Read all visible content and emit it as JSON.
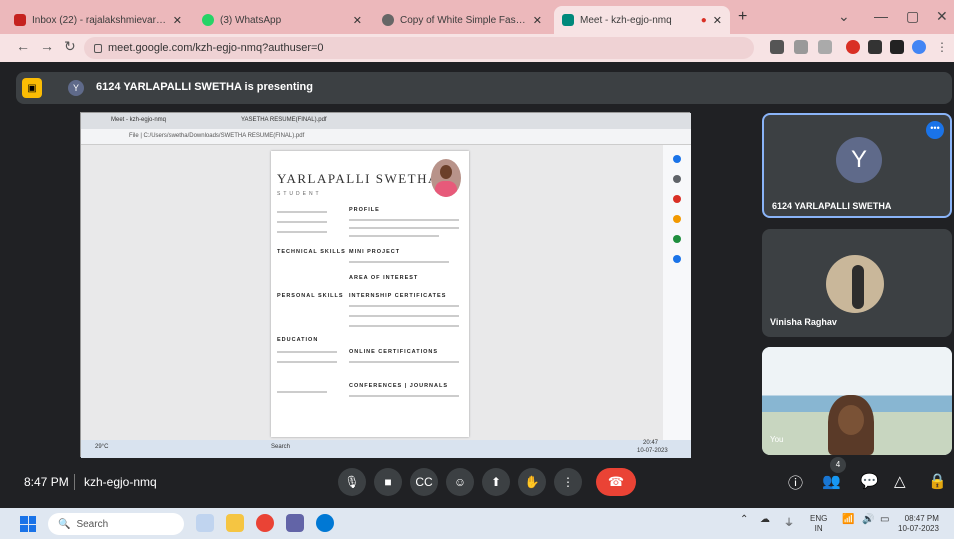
{
  "browser": {
    "tabs": [
      {
        "title": "Inbox (22) - rajalakshmievar@m",
        "color": "#c5221f"
      },
      {
        "title": "(3) WhatsApp",
        "color": "#25d366"
      },
      {
        "title": "Copy of White Simple Fashion D",
        "color": "#666666"
      },
      {
        "title": "Meet - kzh-egjo-nmq",
        "color": "#00897b"
      }
    ],
    "new_tab": "+",
    "url": "meet.google.com/kzh-egjo-nmq?authuser=0"
  },
  "meet": {
    "presenter_initial": "Y",
    "presenting_text": "6124 YARLAPALLI SWETHA is presenting",
    "time": "8:47 PM",
    "meeting_code": "kzh-egjo-nmq",
    "participant_count": "4",
    "tiles": [
      {
        "name": "6124 YARLAPALLI SWETHA",
        "initial": "Y"
      },
      {
        "name": "Vinisha Raghav"
      },
      {
        "name": "You"
      }
    ]
  },
  "shared_screen": {
    "tab1": "Meet - kzh-egjo-nmq",
    "tab2": "YASETHA RESUME(FINAL).pdf",
    "path": "File | C:/Users/swetha/Downloads/SWETHA RESUME(FINAL).pdf",
    "resume": {
      "name": "YARLAPALLI SWETHA",
      "role": "STUDENT",
      "sections_left": [
        "TECHNICAL SKILLS",
        "PERSONAL SKILLS",
        "EDUCATION"
      ],
      "sections_right": [
        "PROFILE",
        "MINI PROJECT",
        "AREA OF INTEREST",
        "INTERNSHIP CERTIFICATES",
        "ONLINE CERTIFICATIONS",
        "CONFERENCES | JOURNALS"
      ]
    },
    "taskbar_search": "Search",
    "taskbar_weather": "29°C",
    "taskbar_time": "20:47",
    "taskbar_date": "10-07-2023"
  },
  "taskbar": {
    "search": "Search",
    "lang": "ENG",
    "region": "IN",
    "time": "08:47 PM",
    "date": "10-07-2023"
  }
}
